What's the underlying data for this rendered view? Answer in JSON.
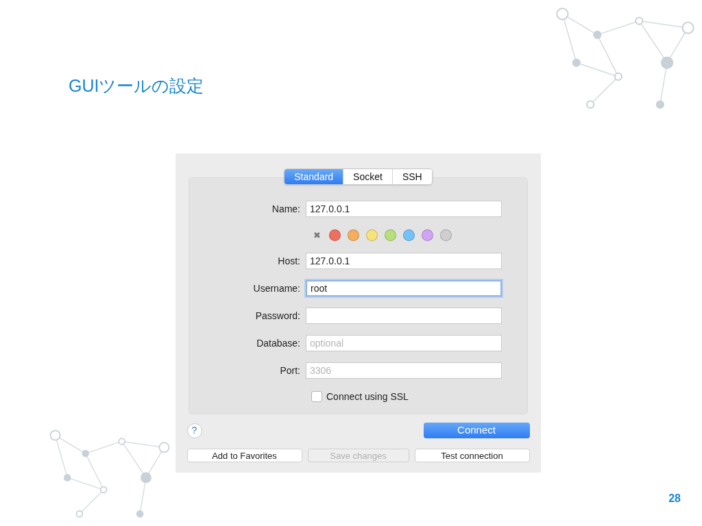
{
  "slide": {
    "title": "GUIツールの設定",
    "page_number": "28"
  },
  "tabs": [
    {
      "label": "Standard",
      "selected": true
    },
    {
      "label": "Socket",
      "selected": false
    },
    {
      "label": "SSH",
      "selected": false
    }
  ],
  "fields": [
    {
      "kind": "text",
      "label": "Name:",
      "value": "127.0.0.1",
      "focused": false
    },
    {
      "kind": "colors",
      "colors": [
        {
          "kind": "clear",
          "label": "✖"
        },
        {
          "kind": "dot",
          "color": "#ef6f5e"
        },
        {
          "kind": "dot",
          "color": "#f6ae5c"
        },
        {
          "kind": "dot",
          "color": "#f8e27a"
        },
        {
          "kind": "dot",
          "color": "#b8e07a"
        },
        {
          "kind": "dot",
          "color": "#76c2f8"
        },
        {
          "kind": "dot",
          "color": "#d2a3f4"
        },
        {
          "kind": "dot",
          "color": "#cfcfcf"
        }
      ]
    },
    {
      "kind": "text",
      "label": "Host:",
      "value": "127.0.0.1",
      "focused": false
    },
    {
      "kind": "text",
      "label": "Username:",
      "value": "root",
      "focused": true
    },
    {
      "kind": "text",
      "label": "Password:",
      "focused": false
    },
    {
      "kind": "text",
      "label": "Database:",
      "placeholder": "optional",
      "focused": false
    },
    {
      "kind": "text",
      "label": "Port:",
      "placeholder": "3306",
      "focused": false
    },
    {
      "kind": "checkbox",
      "label": "Connect using SSL",
      "checked": false
    }
  ],
  "help_button": "?",
  "connect_button": "Connect",
  "buttons": [
    {
      "label": "Add to Favorites",
      "disabled": false
    },
    {
      "label": "Save changes",
      "disabled": true
    },
    {
      "label": "Test connection",
      "disabled": false
    }
  ]
}
